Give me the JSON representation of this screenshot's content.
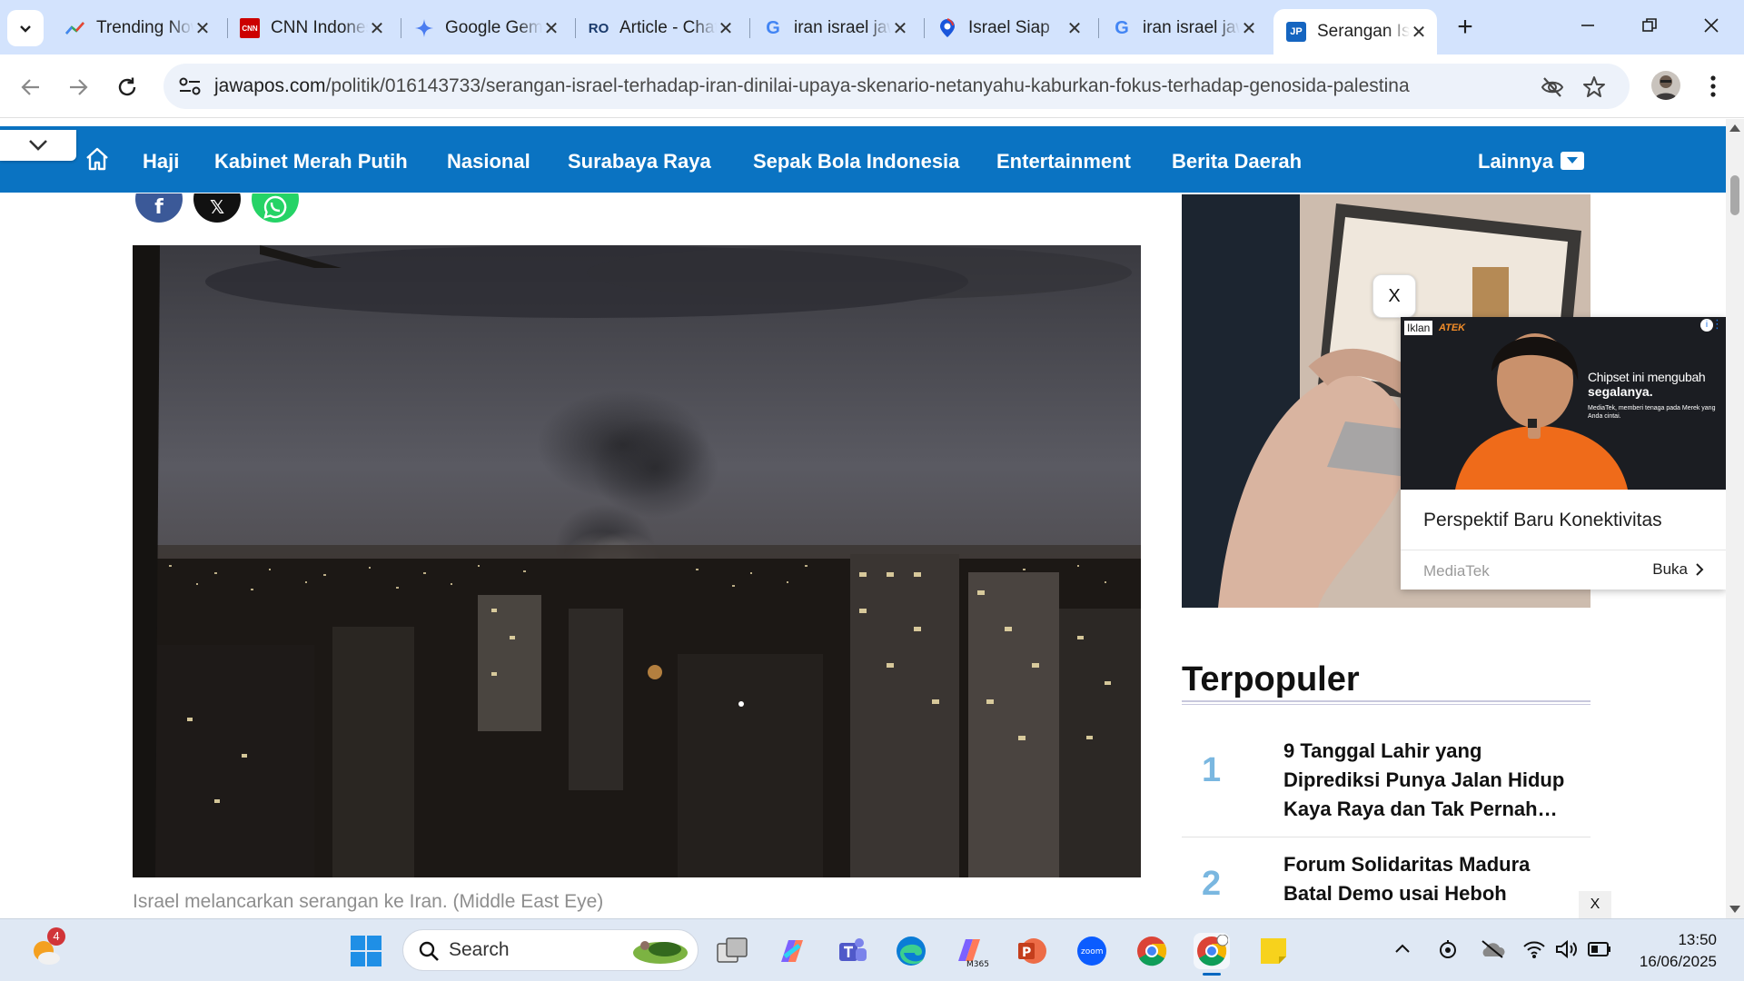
{
  "browser": {
    "tabs": [
      {
        "title": "Trending Now",
        "favicon": "trending-chart-icon"
      },
      {
        "title": "CNN Indonesia",
        "favicon": "cnn-logo-icon",
        "badge": "CNN"
      },
      {
        "title": "Google Gemini",
        "favicon": "gemini-sparkle-icon"
      },
      {
        "title": "Article - ChatGPT",
        "favicon": "ro-logo-icon",
        "badge": "RO"
      },
      {
        "title": "iran israel jawapos",
        "favicon": "google-g-icon",
        "badge": "G"
      },
      {
        "title": "Israel Siap",
        "favicon": "map-pin-icon"
      },
      {
        "title": "iran israel jawapos",
        "favicon": "google-g-icon",
        "badge": "G"
      },
      {
        "title": "Serangan Israel",
        "favicon": "jawapos-logo-icon",
        "badge": "JP",
        "active": true
      }
    ],
    "url_domain": "jawapos.com",
    "url_path": "/politik/016143733/serangan-israel-terhadap-iran-dinilai-upaya-skenario-netanyahu-kaburkan-fokus-terhadap-genosida-palestina"
  },
  "site_nav": {
    "items": [
      "Haji",
      "Kabinet Merah Putih",
      "Nasional",
      "Surabaya Raya",
      "Sepak Bola Indonesia",
      "Entertainment",
      "Berita Daerah"
    ],
    "more_label": "Lainnya"
  },
  "share": {
    "x_label": "𝕏"
  },
  "article": {
    "caption": "Israel melancarkan serangan ke Iran. (Middle East Eye)"
  },
  "ad": {
    "close_label": "X",
    "iklan_label": "Iklan",
    "brand_fragment": "ATEK",
    "headline_line1": "Chipset ini mengubah",
    "headline_line2": "segalanya.",
    "fine_print": "MediaTek, memberi tenaga pada Merek yang Anda cintai.",
    "title": "Perspektif Baru Konektivitas",
    "advertiser": "MediaTek",
    "cta": "Buka"
  },
  "popular": {
    "heading": "Terpopuler",
    "items": [
      {
        "rank": "1",
        "text": "9 Tanggal Lahir yang Diprediksi Punya Jalan Hidup Kaya Raya dan Tak Pernah…"
      },
      {
        "rank": "2",
        "text": "Forum Solidaritas Madura Batal Demo usai Heboh"
      }
    ],
    "close_label": "X"
  },
  "taskbar": {
    "search_placeholder": "Search",
    "weather_badge": "4",
    "time": "13:50",
    "date": "16/06/2025"
  },
  "colors": {
    "site_blue": "#0a73c2",
    "tabbar_bg": "#d3e3fd",
    "facebook": "#3b5998",
    "whatsapp": "#25d366"
  }
}
